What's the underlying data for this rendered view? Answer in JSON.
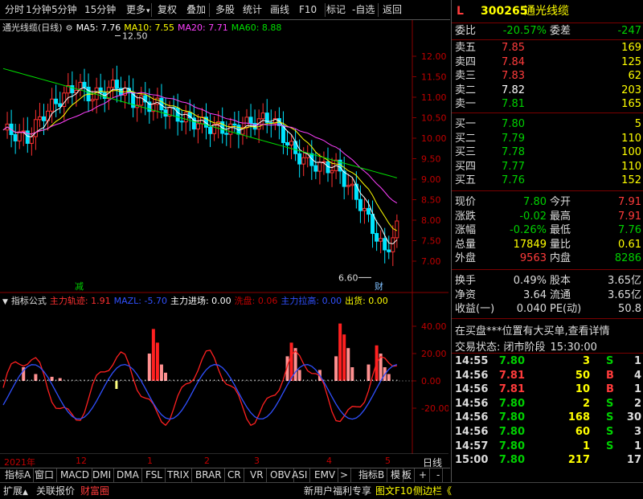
{
  "toolbar": {
    "items": [
      "分时",
      "1分钟",
      "5分钟",
      "15分钟",
      "更多",
      "复权",
      "叠加",
      "多股",
      "统计",
      "画线",
      "F10",
      "标记",
      "-自选",
      "返回"
    ]
  },
  "chart": {
    "title": "通光线缆(日线)",
    "ma": [
      {
        "label": "MA5: 7.76",
        "color": "#ffffff"
      },
      {
        "label": "MA10: 7.55",
        "color": "#ffff00"
      },
      {
        "label": "MA20: 7.71",
        "color": "#ff40ff"
      },
      {
        "label": "MA60: 8.88",
        "color": "#00e000"
      }
    ],
    "price_axis": [
      "12.00",
      "11.50",
      "11.00",
      "10.50",
      "10.00",
      "9.50",
      "9.00",
      "8.50",
      "8.00",
      "7.50",
      "7.00"
    ],
    "high_label": "12.50",
    "low_label": "6.60",
    "marker_jian": "减",
    "marker_cai": "财",
    "indicator_title": "指标公式",
    "indicator_vals": [
      {
        "t": "主力轨迹: 1.91",
        "c": "#ff3030"
      },
      {
        "t": "MAZL: -5.70",
        "c": "#3050ff"
      },
      {
        "t": "主力进场: 0.00",
        "c": "#ffffff"
      },
      {
        "t": "洗盘: 0.06",
        "c": "#c00000"
      },
      {
        "t": "主力拉高: 0.00",
        "c": "#3050ff"
      },
      {
        "t": "出货: 0.00",
        "c": "#ffff00"
      }
    ],
    "ind_axis": [
      "40.00",
      "20.00",
      "0.00",
      "-20.00"
    ],
    "time_axis": [
      "2021年",
      "12",
      "1",
      "2",
      "3",
      "4",
      "5"
    ],
    "right_label": "日线"
  },
  "quote": {
    "header": {
      "flag": "L",
      "code": "300265",
      "name": "通光线缆"
    },
    "weibi": {
      "label": "委比",
      "value": "-20.57%",
      "label2": "委差",
      "value2": "-247"
    },
    "sell": [
      {
        "l": "卖五",
        "p": "7.85",
        "v": "169"
      },
      {
        "l": "卖四",
        "p": "7.84",
        "v": "125"
      },
      {
        "l": "卖三",
        "p": "7.83",
        "v": "62"
      },
      {
        "l": "卖二",
        "p": "7.82",
        "v": "203"
      },
      {
        "l": "卖一",
        "p": "7.81",
        "v": "165"
      }
    ],
    "buy": [
      {
        "l": "买一",
        "p": "7.80",
        "v": "5"
      },
      {
        "l": "买二",
        "p": "7.79",
        "v": "110"
      },
      {
        "l": "买三",
        "p": "7.78",
        "v": "100"
      },
      {
        "l": "买四",
        "p": "7.77",
        "v": "110"
      },
      {
        "l": "买五",
        "p": "7.76",
        "v": "152"
      }
    ],
    "stats": [
      {
        "l1": "现价",
        "v1": "7.80",
        "l2": "今开",
        "v2": "7.91"
      },
      {
        "l1": "涨跌",
        "v1": "-0.02",
        "l2": "最高",
        "v2": "7.91"
      },
      {
        "l1": "涨幅",
        "v1": "-0.26%",
        "l2": "最低",
        "v2": "7.76"
      },
      {
        "l1": "总量",
        "v1": "17849",
        "l2": "量比",
        "v2": "0.61"
      },
      {
        "l1": "外盘",
        "v1": "9563",
        "l2": "内盘",
        "v2": "8286"
      }
    ],
    "fund": [
      {
        "l1": "换手",
        "v1": "0.49%",
        "l2": "股本",
        "v2": "3.65亿"
      },
      {
        "l1": "净资",
        "v1": "3.64",
        "l2": "流通",
        "v2": "3.65亿"
      },
      {
        "l1": "收益(一)",
        "v1": "0.040",
        "l2": "PE(动)",
        "v2": "50.8"
      }
    ],
    "notice": "在买盘***位置有大买单,查看详情",
    "status_label": "交易状态: 闭市阶段",
    "status_time": "15:30:00",
    "ticks": [
      {
        "t": "14:55",
        "p": "7.80",
        "v": "3",
        "s": "S",
        "n": "1"
      },
      {
        "t": "14:56",
        "p": "7.81",
        "v": "50",
        "s": "B",
        "n": "4"
      },
      {
        "t": "14:56",
        "p": "7.81",
        "v": "10",
        "s": "B",
        "n": "1"
      },
      {
        "t": "14:56",
        "p": "7.80",
        "v": "2",
        "s": "S",
        "n": "2"
      },
      {
        "t": "14:56",
        "p": "7.80",
        "v": "168",
        "s": "S",
        "n": "30"
      },
      {
        "t": "14:56",
        "p": "7.80",
        "v": "60",
        "s": "S",
        "n": "3"
      },
      {
        "t": "14:57",
        "p": "7.80",
        "v": "1",
        "s": "S",
        "n": "1"
      },
      {
        "t": "15:00",
        "p": "7.80",
        "v": "217",
        "s": "",
        "n": "17"
      }
    ],
    "tabs": [
      "笔",
      "价",
      "细",
      "势",
      "联",
      "值",
      "主",
      "更"
    ]
  },
  "indicator_tabs": [
    "指标A",
    "窗口",
    "MACD",
    "DMI",
    "DMA",
    "FSL",
    "TRIX",
    "BRAR",
    "CR",
    "VR",
    "OBV",
    "ASI",
    "EMV",
    ">",
    "指标B",
    "模",
    "板",
    "+",
    "-"
  ],
  "bottom": {
    "left": [
      "扩展",
      "关联报价",
      "财富圈"
    ],
    "right": [
      "新用户福利专享",
      "图文F10",
      "侧边栏《"
    ]
  }
}
